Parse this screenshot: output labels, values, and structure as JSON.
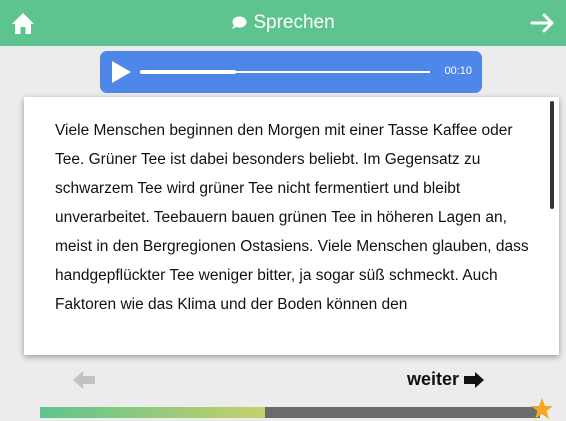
{
  "header": {
    "title": "Sprechen",
    "home_icon": "home-icon",
    "next_icon": "arrow-right-icon",
    "background": "#5ec48f"
  },
  "player": {
    "time": "00:10",
    "progress": 0.03,
    "background": "#4f87e8"
  },
  "content": {
    "text": "Viele Menschen beginnen den Morgen mit einer Tasse Kaffee oder Tee. Grüner Tee ist dabei besonders beliebt. Im Gegensatz zu schwarzem Tee wird grüner Tee nicht fermentiert und bleibt unverarbeitet. Teebauern bauen grünen Tee in höheren Lagen an, meist in den Bergregionen Ostasiens. Viele Menschen glauben, dass handgepflückter Tee weniger bitter, ja sogar süß schmeckt. Auch Faktoren wie das Klima und der Boden können den"
  },
  "navigation": {
    "next_label": "weiter"
  },
  "lesson_progress": {
    "fraction": 0.45,
    "star_icon": "star-icon",
    "star_color": "#f5a623"
  }
}
